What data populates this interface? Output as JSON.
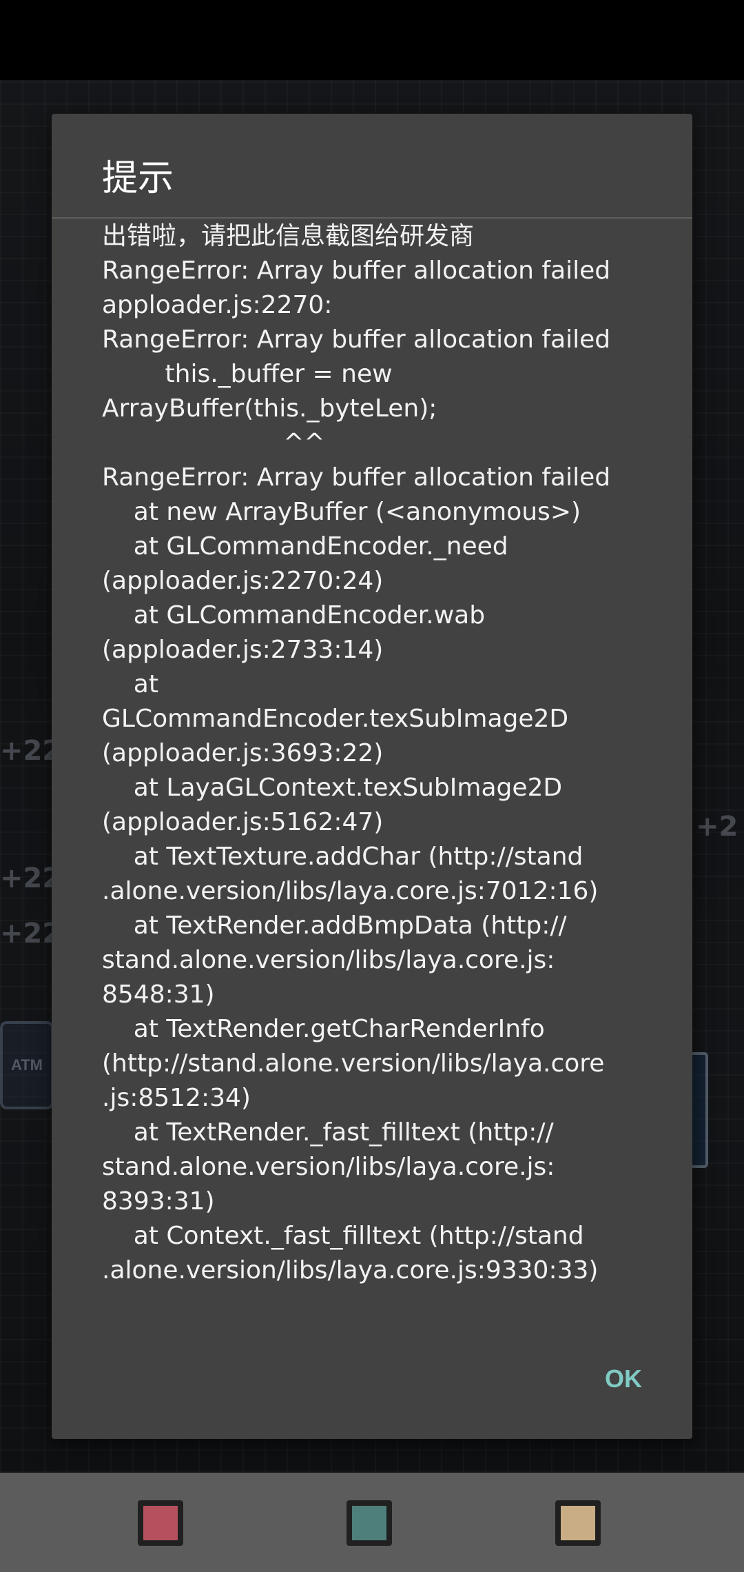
{
  "dialog": {
    "title": "提示",
    "message": "出错啦，请把此信息截图给研发商\nRangeError: Array buffer allocation failed\napploader.js:2270:\nRangeError: Array buffer allocation failed\n        this._buffer = new\nArrayBuffer(this._byteLen);\n                       ^^\nRangeError: Array buffer allocation failed\n    at new ArrayBuffer (<anonymous>)\n    at GLCommandEncoder._need\n(apploader.js:2270:24)\n    at GLCommandEncoder.wab\n(apploader.js:2733:14)\n    at\nGLCommandEncoder.texSubImage2D\n(apploader.js:3693:22)\n    at LayaGLContext.texSubImage2D\n(apploader.js:5162:47)\n    at TextTexture.addChar (http://stand\n.alone.version/libs/laya.core.js:7012:16)\n    at TextRender.addBmpData (http://\nstand.alone.version/libs/laya.core.js:\n8548:31)\n    at TextRender.getCharRenderInfo\n(http://stand.alone.version/libs/laya.core\n.js:8512:34)\n    at TextRender._fast_filltext (http://\nstand.alone.version/libs/laya.core.js:\n8393:31)\n    at Context._fast_filltext (http://stand\n.alone.version/libs/laya.core.js:9330:33)",
    "ok_label": "OK"
  },
  "background": {
    "badges": [
      "+22",
      "+22",
      "+22",
      "+2"
    ],
    "atm_label": "ATM"
  },
  "nav_bar": {
    "buttons": [
      {
        "name": "nav-button-red",
        "color": "#b5505e"
      },
      {
        "name": "nav-button-teal",
        "color": "#4e7f7b"
      },
      {
        "name": "nav-button-tan",
        "color": "#c9ad85"
      }
    ]
  }
}
